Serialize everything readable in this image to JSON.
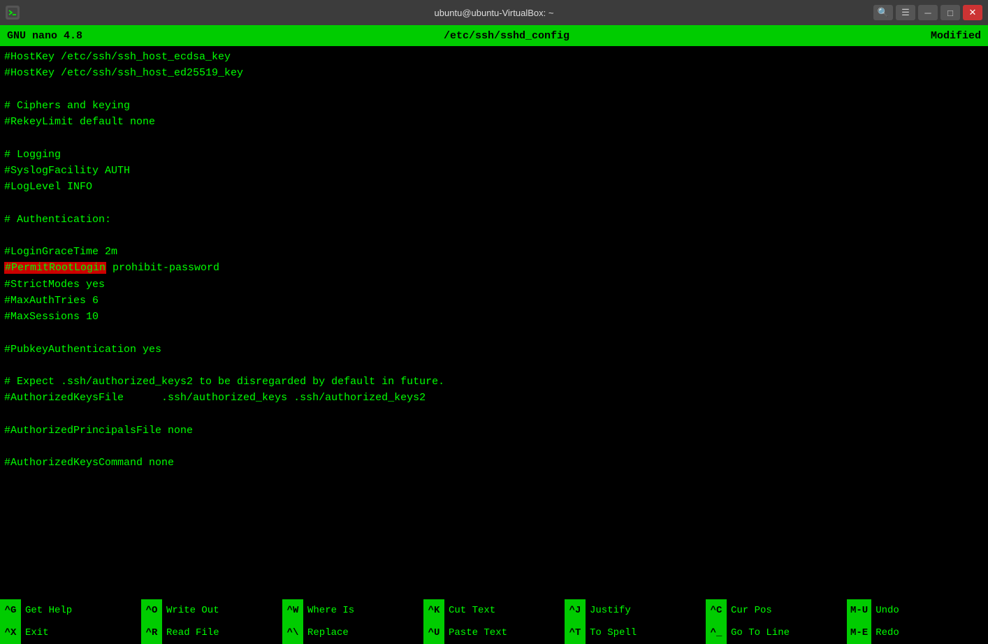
{
  "titlebar": {
    "title": "ubuntu@ubuntu-VirtualBox: ~",
    "icon": "T",
    "search_icon": "🔍",
    "menu_icon": "☰",
    "minimize_icon": "─",
    "maximize_icon": "□",
    "close_icon": "✕"
  },
  "nano_header": {
    "left": "GNU nano 4.8",
    "center": "/etc/ssh/sshd_config",
    "right": "Modified"
  },
  "editor": {
    "lines": [
      "#HostKey /etc/ssh/ssh_host_ecdsa_key",
      "#HostKey /etc/ssh/ssh_host_ed25519_key",
      "",
      "# Ciphers and keying",
      "#RekeyLimit default none",
      "",
      "# Logging",
      "#SyslogFacility AUTH",
      "#LogLevel INFO",
      "",
      "# Authentication:",
      "",
      "#LoginGraceTime 2m",
      "#PermitRootLogin prohibit-password",
      "#StrictModes yes",
      "#MaxAuthTries 6",
      "#MaxSessions 10",
      "",
      "#PubkeyAuthentication yes",
      "",
      "# Expect .ssh/authorized_keys2 to be disregarded by default in future.",
      "#AuthorizedKeysFile      .ssh/authorized_keys .ssh/authorized_keys2",
      "",
      "#AuthorizedPrincipalsFile none",
      "",
      "#AuthorizedKeysCommand none"
    ],
    "highlighted_line_index": 13,
    "highlighted_text": "#PermitRootLogin",
    "rest_of_highlighted": " prohibit-password"
  },
  "shortcuts": {
    "row1": [
      {
        "key": "^G",
        "label": "Get Help"
      },
      {
        "key": "^O",
        "label": "Write Out"
      },
      {
        "key": "^W",
        "label": "Where Is"
      },
      {
        "key": "^K",
        "label": "Cut Text"
      },
      {
        "key": "^J",
        "label": "Justify"
      },
      {
        "key": "^C",
        "label": "Cur Pos"
      },
      {
        "key": "M-U",
        "label": "Undo"
      }
    ],
    "row2": [
      {
        "key": "^X",
        "label": "Exit"
      },
      {
        "key": "^R",
        "label": "Read File"
      },
      {
        "key": "^\\",
        "label": "Replace"
      },
      {
        "key": "^U",
        "label": "Paste Text"
      },
      {
        "key": "^T",
        "label": "To Spell"
      },
      {
        "key": "^_",
        "label": "Go To Line"
      },
      {
        "key": "M-E",
        "label": "Redo"
      }
    ]
  }
}
